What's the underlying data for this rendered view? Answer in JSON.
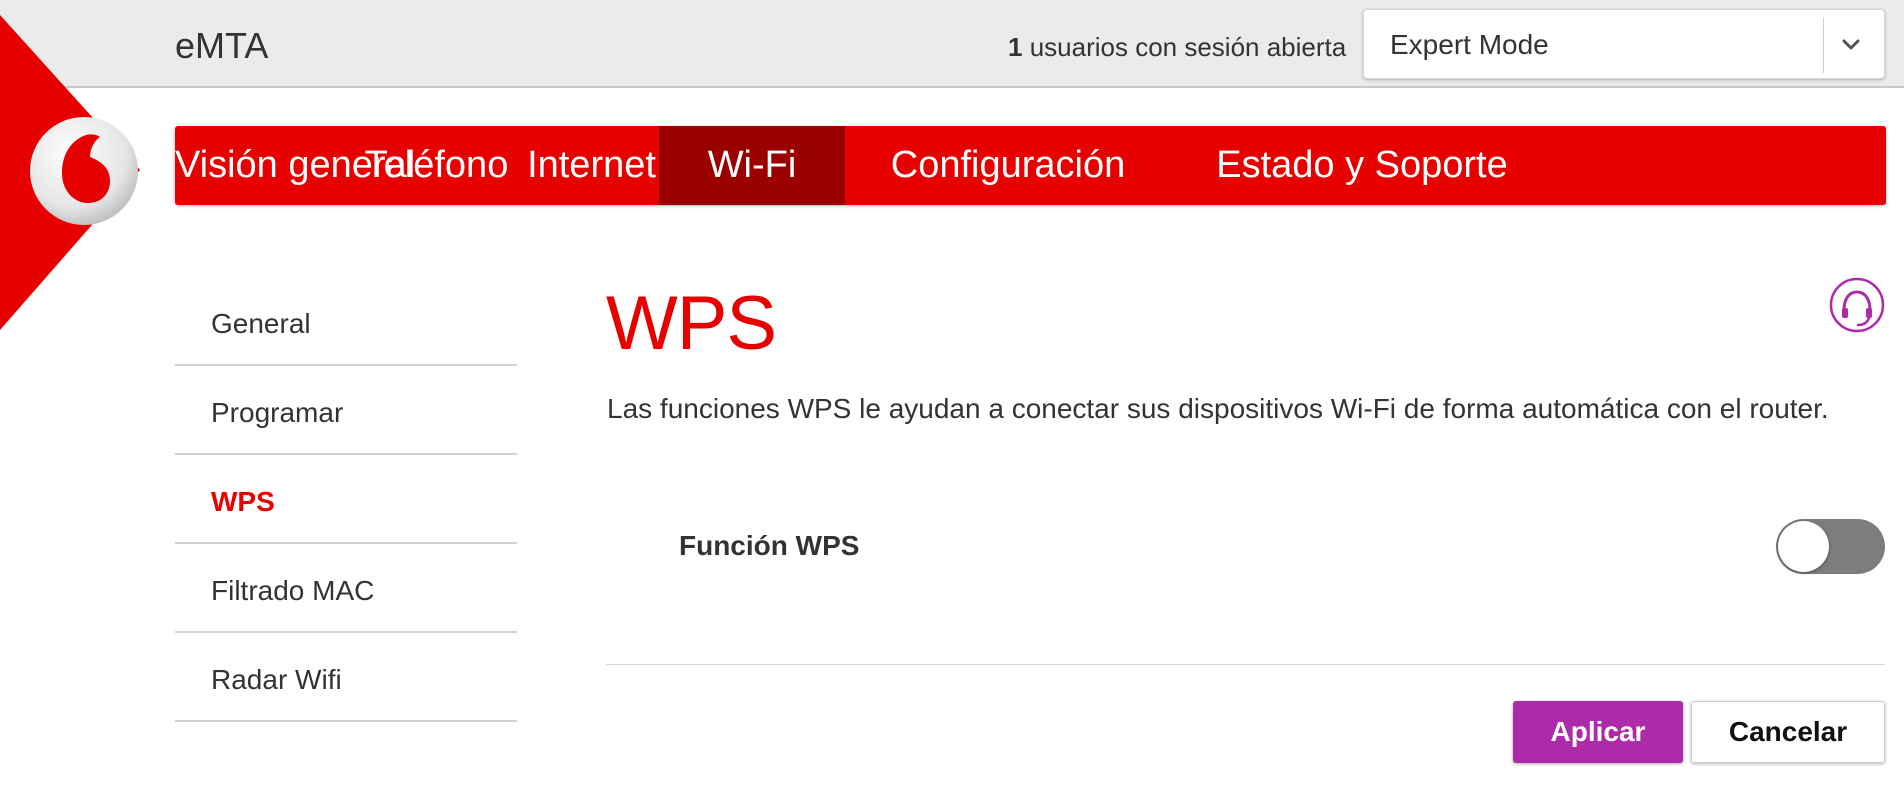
{
  "header": {
    "app_title": "eMTA",
    "session_count": "1",
    "session_text": "usuarios con sesión abierta",
    "mode_select": {
      "value": "Expert Mode",
      "icon": "chevron-down-icon"
    }
  },
  "brand": {
    "primary_color": "#e60000",
    "active_nav_color": "#9b0000",
    "accent_color": "#ad2aa8",
    "logo": "vodafone-logo"
  },
  "nav": {
    "items": [
      {
        "label": "Visión general"
      },
      {
        "label": "Teléfono"
      },
      {
        "label": "Internet"
      },
      {
        "label": "Wi-Fi",
        "active": true
      },
      {
        "label": "Configuración"
      },
      {
        "label": "Estado y Soporte"
      }
    ]
  },
  "sidebar": {
    "items": [
      {
        "label": "General"
      },
      {
        "label": "Programar"
      },
      {
        "label": "WPS",
        "active": true
      },
      {
        "label": "Filtrado MAC"
      },
      {
        "label": "Radar Wifi"
      }
    ]
  },
  "main": {
    "title": "WPS",
    "help_icon": "help-icon",
    "description": "Las funciones WPS le ayudan a conectar sus dispositivos Wi-Fi de forma automática con el router.",
    "wps_toggle": {
      "label": "Función WPS",
      "enabled": false
    },
    "buttons": {
      "apply": "Aplicar",
      "cancel": "Cancelar"
    }
  }
}
